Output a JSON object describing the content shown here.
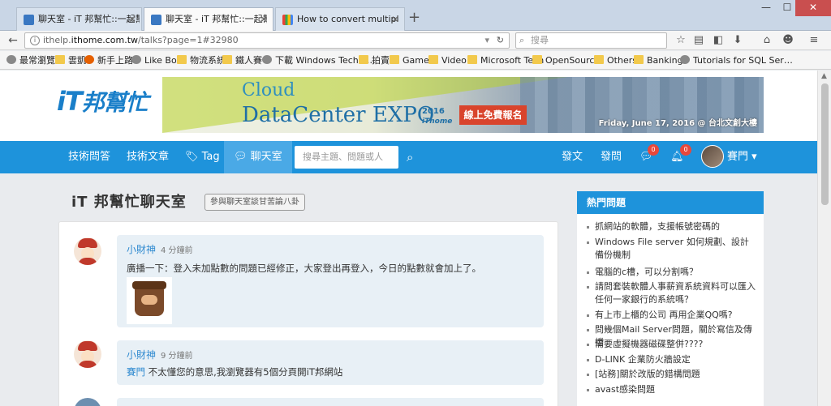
{
  "browser": {
    "tabs": [
      {
        "title": "聊天室 - iT 邦幫忙::一起幫…",
        "state": "inactive"
      },
      {
        "title": "聊天室 - iT 邦幫忙::一起幫…",
        "state": "active"
      },
      {
        "title": "How to convert multiple…",
        "state": "inactive"
      }
    ],
    "new_tab": "+",
    "window_controls": {
      "minimize": "—",
      "maximize": "☐",
      "close": "✕"
    },
    "url_prefix": "ithelp.",
    "url_domain": "ithome.com.tw",
    "url_path": "/talks?page=1#32980",
    "search_placeholder": "搜尋",
    "bookmarks": [
      {
        "label": "最常瀏覽",
        "icon": "gear-icon"
      },
      {
        "label": "雲凱",
        "icon": "folder-icon"
      },
      {
        "label": "新手上路",
        "icon": "firefox-icon"
      },
      {
        "label": "Like Box",
        "icon": "globe-icon"
      },
      {
        "label": "物流系統",
        "icon": "folder-icon"
      },
      {
        "label": "鐵人賽",
        "icon": "folder-icon"
      },
      {
        "label": "下載 Windows Techni…",
        "icon": "globe-icon"
      },
      {
        "label": "拍賣",
        "icon": "folder-icon"
      },
      {
        "label": "Game",
        "icon": "folder-icon"
      },
      {
        "label": "Video",
        "icon": "folder-icon"
      },
      {
        "label": "Microsoft Tech",
        "icon": "folder-icon"
      },
      {
        "label": "OpenSource",
        "icon": "folder-icon"
      },
      {
        "label": "Others",
        "icon": "folder-icon"
      },
      {
        "label": "Banking",
        "icon": "folder-icon"
      },
      {
        "label": "Tutorials for SQL Ser…",
        "icon": "globe-icon"
      }
    ]
  },
  "site": {
    "logo_latin": "iT",
    "logo_zh": "邦幫忙",
    "banner": {
      "cloud": "Cloud",
      "datacenter": "DataCenter EXPO",
      "year": "2016",
      "brand": "iThome",
      "register": "線上免費報名",
      "date": "Friday, June 17, 2016 @ 台北文創大樓"
    },
    "nav": {
      "qa": "技術問答",
      "articles": "技術文章",
      "tag": "Tag",
      "chat": "聊天室",
      "search_placeholder": "搜尋主題、問題或人",
      "post": "發文",
      "ask": "發問",
      "msg_count": "0",
      "notify_count": "0",
      "user": "賽門"
    },
    "page_title": "iT 邦幫忙聊天室",
    "page_tag": "參與聊天室談甘苦論八卦",
    "messages": [
      {
        "author": "小財神",
        "time": "4 分鐘前",
        "text": "廣播一下：登入未加點數的問題已經修正，大家登出再登入，今日的點數就會加上了。",
        "has_sticker": true
      },
      {
        "author": "小財神",
        "time": "9 分鐘前",
        "mention": "賽門",
        "text": " 不太懂您的意思,我瀏覽器有5個分頁開iT邦網站"
      }
    ],
    "sidebar": {
      "title": "熱門問題",
      "items": [
        "抓網站的軟體，支援帳號密碼的",
        "Windows File server 如何規劃、設計備份機制",
        "電腦的c槽，可以分割嗎？",
        "請問套裝軟體人事薪資系統資料可以匯入任何一家銀行的系統嗎？",
        "有上市上櫃的公司 再用企業QQ嗎?",
        "問幾個Mail Server問題，關於寫信及傳擋",
        "需要虛擬機器磁碟整併????",
        "D-LINK 企業防火牆設定",
        "[站務]關於改版的錯構問題",
        "avast感染問題"
      ]
    }
  }
}
